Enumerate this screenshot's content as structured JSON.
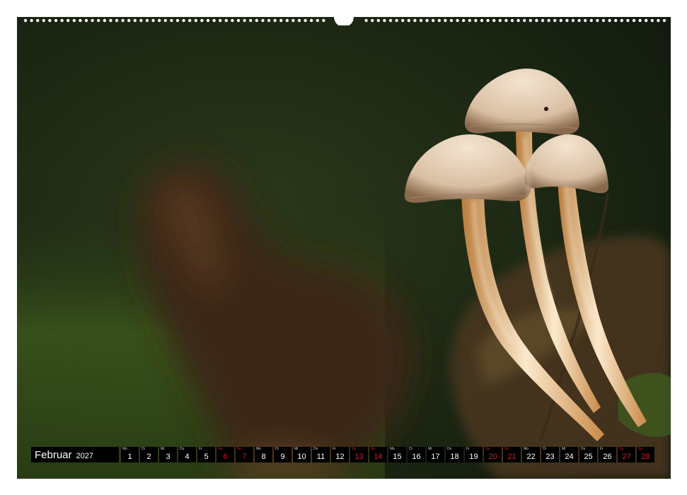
{
  "calendar": {
    "month": "Februar",
    "year": "2027",
    "days": [
      {
        "wd": "Mo",
        "d": "1",
        "weekend": false
      },
      {
        "wd": "Di",
        "d": "2",
        "weekend": false
      },
      {
        "wd": "Mi",
        "d": "3",
        "weekend": false
      },
      {
        "wd": "Do",
        "d": "4",
        "weekend": false
      },
      {
        "wd": "Fr",
        "d": "5",
        "weekend": false
      },
      {
        "wd": "Sa",
        "d": "6",
        "weekend": true
      },
      {
        "wd": "So",
        "d": "7",
        "weekend": true
      },
      {
        "wd": "Mo",
        "d": "8",
        "weekend": false
      },
      {
        "wd": "Di",
        "d": "9",
        "weekend": false
      },
      {
        "wd": "Mi",
        "d": "10",
        "weekend": false
      },
      {
        "wd": "Do",
        "d": "11",
        "weekend": false
      },
      {
        "wd": "Fr",
        "d": "12",
        "weekend": false
      },
      {
        "wd": "Sa",
        "d": "13",
        "weekend": true
      },
      {
        "wd": "So",
        "d": "14",
        "weekend": true
      },
      {
        "wd": "Mo",
        "d": "15",
        "weekend": false
      },
      {
        "wd": "Di",
        "d": "16",
        "weekend": false
      },
      {
        "wd": "Mi",
        "d": "17",
        "weekend": false
      },
      {
        "wd": "Do",
        "d": "18",
        "weekend": false
      },
      {
        "wd": "Fr",
        "d": "19",
        "weekend": false
      },
      {
        "wd": "Sa",
        "d": "20",
        "weekend": true
      },
      {
        "wd": "So",
        "d": "21",
        "weekend": true
      },
      {
        "wd": "Mo",
        "d": "22",
        "weekend": false
      },
      {
        "wd": "Di",
        "d": "23",
        "weekend": false
      },
      {
        "wd": "Mi",
        "d": "24",
        "weekend": false
      },
      {
        "wd": "Do",
        "d": "25",
        "weekend": false
      },
      {
        "wd": "Fr",
        "d": "26",
        "weekend": false
      },
      {
        "wd": "Sa",
        "d": "27",
        "weekend": true
      },
      {
        "wd": "So",
        "d": "28",
        "weekend": true
      }
    ]
  },
  "colors": {
    "weekend": "#d11f2a",
    "background_dark": "#1a2414",
    "mushroom_cap": "#e8d3bb"
  }
}
